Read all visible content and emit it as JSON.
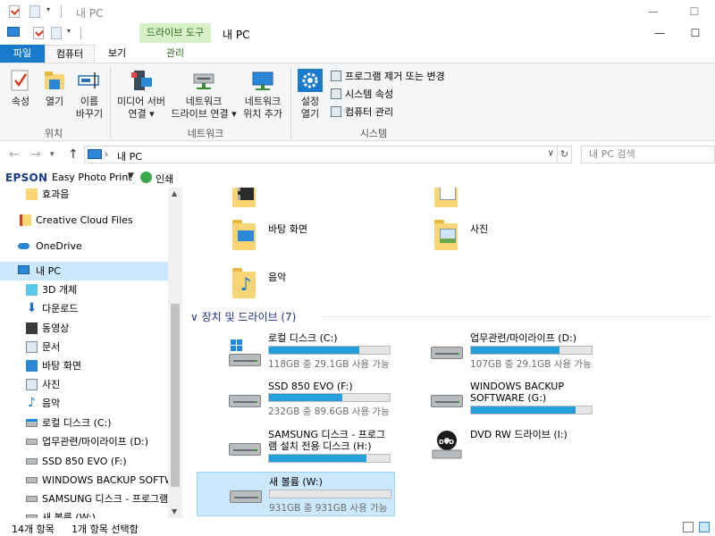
{
  "window": {
    "title": "내 PC",
    "context_group": "드라이브 도구",
    "minimize": "—",
    "maximize": "☐"
  },
  "ribbon": {
    "tabs": {
      "file": "파일",
      "computer": "컴퓨터",
      "view": "보기",
      "manage": "관리"
    },
    "buttons": {
      "properties": "속성",
      "open": "열기",
      "rename_line1": "이름",
      "rename_line2": "바꾸기",
      "media_server_line1": "미디어 서버",
      "media_server_line2": "연결",
      "map_drive_line1": "네트워크",
      "map_drive_line2": "드라이브 연결",
      "add_location_line1": "네트워크",
      "add_location_line2": "위치 추가",
      "settings_line1": "설정",
      "settings_line2": "열기"
    },
    "small_buttons": {
      "uninstall": "프로그램 제거 또는 변경",
      "system_properties": "시스템 속성",
      "computer_management": "컴퓨터 관리"
    },
    "groups": {
      "location": "위치",
      "network": "네트워크",
      "system": "시스템"
    }
  },
  "address": {
    "path": "내 PC",
    "search_placeholder": "내 PC 검색"
  },
  "epson": {
    "logo": "EPSON",
    "app": "Easy Photo Print",
    "print": "인쇄"
  },
  "navpane": {
    "items": [
      {
        "label": "효과음",
        "icon": "folder-icon"
      },
      {
        "label": "Creative Cloud Files",
        "icon": "creative-cloud-folder-icon"
      },
      {
        "label": "OneDrive",
        "icon": "onedrive-cloud-icon"
      },
      {
        "label": "내 PC",
        "icon": "pc-icon"
      },
      {
        "label": "3D 개체",
        "icon": "3d-objects-icon"
      },
      {
        "label": "다운로드",
        "icon": "download-arrow-icon"
      },
      {
        "label": "동영상",
        "icon": "video-folder-icon"
      },
      {
        "label": "문서",
        "icon": "document-folder-icon"
      },
      {
        "label": "바탕 화면",
        "icon": "desktop-folder-icon"
      },
      {
        "label": "사진",
        "icon": "pictures-folder-icon"
      },
      {
        "label": "음악",
        "icon": "music-note-icon"
      },
      {
        "label": "로컬 디스크 (C:)",
        "icon": "system-drive-icon"
      },
      {
        "label": "업무관련/마이라이프 (D:)",
        "icon": "hard-drive-icon"
      },
      {
        "label": "SSD 850 EVO (F:)",
        "icon": "hard-drive-icon"
      },
      {
        "label": "WINDOWS BACKUP SOFTWARE (G:)",
        "icon": "hard-drive-icon"
      },
      {
        "label": "SAMSUNG 디스크 - 프로그램 설치 전용 디스크 (H:)",
        "icon": "hard-drive-icon"
      },
      {
        "label": "새 볼륨 (W:)",
        "icon": "hard-drive-icon"
      }
    ]
  },
  "content": {
    "folders": [
      {
        "label": "",
        "icon": "video-folder-icon"
      },
      {
        "label": "",
        "icon": "document-folder-icon"
      },
      {
        "label": "바탕 화면",
        "icon": "desktop-folder-icon"
      },
      {
        "label": "사진",
        "icon": "pictures-folder-icon"
      },
      {
        "label": "음악",
        "icon": "music-folder-icon"
      }
    ],
    "section_header": "장치 및 드라이브 (7)",
    "drives": [
      {
        "name": "로컬 디스크 (C:)",
        "info": "118GB 중 29.1GB 사용 가능",
        "used_fraction": 0.75
      },
      {
        "name": "업무관련/마이라이프 (D:)",
        "info": "107GB 중 29.1GB 사용 가능",
        "used_fraction": 0.73
      },
      {
        "name": "SSD 850 EVO (F:)",
        "info": "232GB 중 89.6GB 사용 가능",
        "used_fraction": 0.61
      },
      {
        "name": "WINDOWS BACKUP SOFTWARE (G:)",
        "info": "",
        "used_fraction": 0.87
      },
      {
        "name": "SAMSUNG 디스크 - 프로그램 설치 전용 디스크 (H:)",
        "info": "",
        "used_fraction": 0.81
      },
      {
        "name": "DVD RW 드라이브 (I:)",
        "info": "",
        "used_fraction": null
      },
      {
        "name": "새 볼륨 (W:)",
        "info": "931GB 중 931GB 사용 가능",
        "used_fraction": 0.0
      }
    ]
  },
  "status": {
    "count": "14개 항목",
    "selected": "1개 항목 선택함"
  },
  "colors": {
    "accent": "#1979ca",
    "selection": "#cce8ff",
    "drive_bar": "#26a0da",
    "context_tab": "#d8f0c8"
  }
}
